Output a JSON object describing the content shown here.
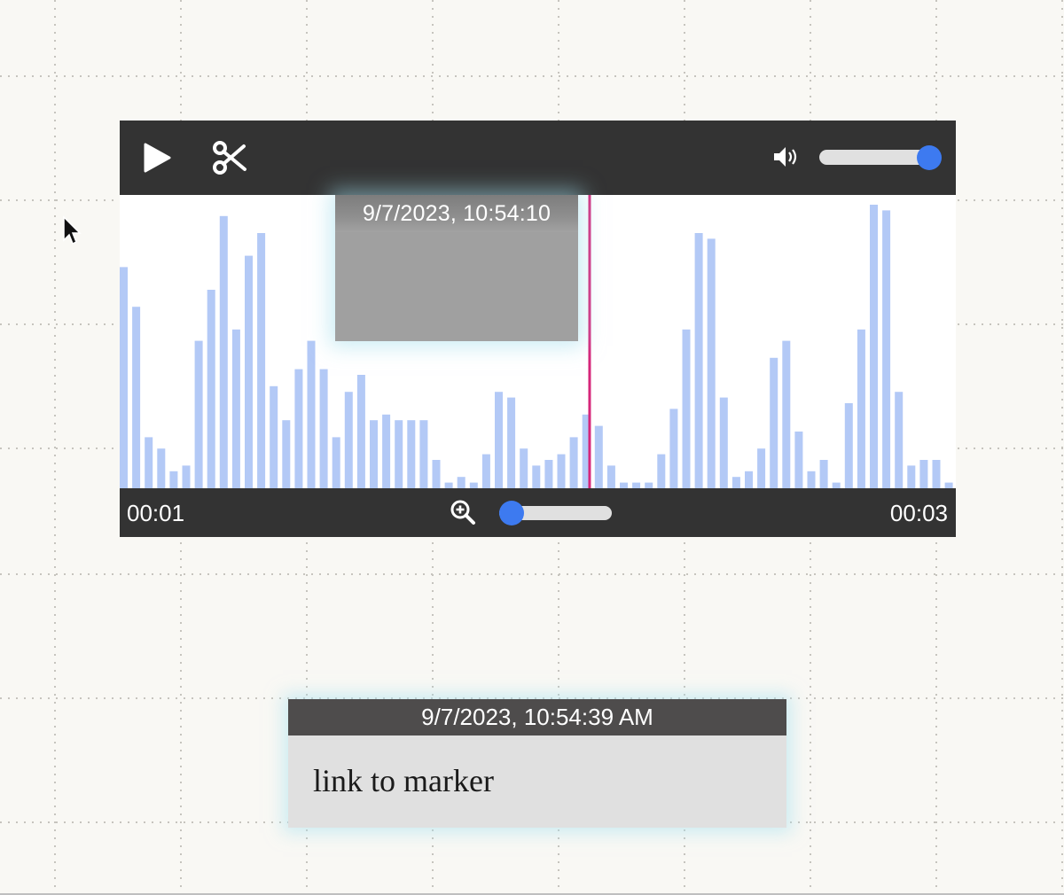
{
  "player": {
    "play_icon": "play-icon",
    "cut_icon": "scissors-icon",
    "volume_icon": "volume-icon",
    "volume_level": 1.0,
    "zoom_icon": "zoom-in-icon",
    "zoom_level": 0.11,
    "time_start": "00:01",
    "time_end": "00:03",
    "accent_color": "#3d7af0",
    "playhead_color": "#d6267a",
    "wave_color": "#b3c9f6",
    "playhead_fraction": 0.562,
    "waveform_levels": [
      0.78,
      0.64,
      0.18,
      0.14,
      0.06,
      0.08,
      0.52,
      0.7,
      0.96,
      0.56,
      0.82,
      0.9,
      0.36,
      0.24,
      0.42,
      0.52,
      0.42,
      0.18,
      0.34,
      0.4,
      0.24,
      0.26,
      0.24,
      0.24,
      0.24,
      0.1,
      0.02,
      0.04,
      0.02,
      0.12,
      0.34,
      0.32,
      0.14,
      0.08,
      0.1,
      0.12,
      0.18,
      0.26,
      0.22,
      0.08,
      0.02,
      0.02,
      0.02,
      0.12,
      0.28,
      0.56,
      0.9,
      0.88,
      0.32,
      0.04,
      0.06,
      0.14,
      0.46,
      0.52,
      0.2,
      0.06,
      0.1,
      0.02,
      0.3,
      0.56,
      1.0,
      0.98,
      0.34,
      0.08,
      0.1,
      0.1,
      0.02
    ]
  },
  "waveform_marker": {
    "timestamp": "9/7/2023, 10:54:10"
  },
  "note_card": {
    "timestamp": "9/7/2023, 10:54:39 AM",
    "text": "link to marker"
  }
}
